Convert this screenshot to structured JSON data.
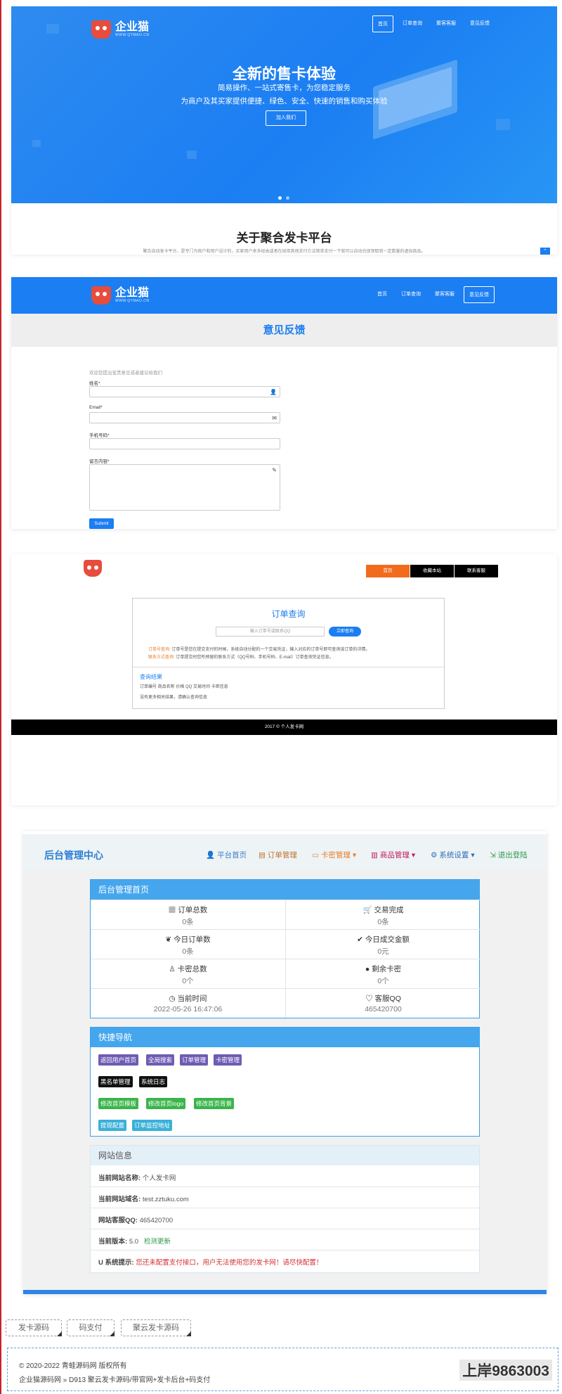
{
  "landing": {
    "logo_text": "企业猫",
    "logo_sub": "WWW.QYMAO.CN",
    "nav": [
      "首页",
      "订单查询",
      "聚客客服",
      "意见反馈"
    ],
    "hero_title": "全新的售卡体验",
    "hero_line1": "简易操作、一站式寄售卡，为您稳定服务",
    "hero_line2": "为商户及其买家提供便捷、绿色、安全、快速的销售和购买体验",
    "hero_button": "加入我们",
    "about_title": "关于聚合发卡平台",
    "about_text": "聚合自动发卡平台，是专门为商户和用户设计的，买家用户来多经由或者在线用其他支付方法简单支付一下就可以自动兑现领取到一定数量的虚拟商品。"
  },
  "feedback": {
    "logo_text": "企业猫",
    "logo_sub": "WWW.QYMAO.CN",
    "nav": [
      "首页",
      "订单查询",
      "聚客客服",
      "意见反馈"
    ],
    "title": "意见反馈",
    "hint": "欢迎您提出宝贵意见或者建议给我们",
    "name_label": "姓名*",
    "email_label": "Email*",
    "phone_label": "手机号码*",
    "message_label": "留言内容*",
    "submit": "Submit"
  },
  "order_query": {
    "buttons": [
      "首页",
      "收藏本站",
      "联系客服"
    ],
    "title": "订单查询",
    "input_placeholder": "输入订单号或联系QQ",
    "query_button": "立即查询",
    "note1_label": "订单号查询:",
    "note1_text": "订单号是您在提交支付的时候，系统自动分配的一个交易凭证，输入对应的订单号即可查询该订单的详情。",
    "note2_label": "联系方式查询:",
    "note2_text": "订单提交时您所预留的联系方式（QQ号码、手机号码、E-mail）订单查询凭证信息。",
    "result_title": "查询结果",
    "result_columns": "订单编号 商品名称 价格 QQ 交易时间 卡密信息",
    "result_empty": "没有更多相关结果，请确认查询信息",
    "footer": "2017 © 个人发卡网"
  },
  "admin": {
    "brand": "后台管理中心",
    "nav": [
      {
        "label": "平台首页",
        "icon": "user-icon",
        "color": "#3a7fc4"
      },
      {
        "label": "订单管理",
        "icon": "list-icon",
        "color": "#c0752a"
      },
      {
        "label": "卡密管理",
        "icon": "credit-card-icon",
        "color": "#e67e22"
      },
      {
        "label": "商品管理",
        "icon": "shop-icon",
        "color": "#c2185b"
      },
      {
        "label": "系统设置",
        "icon": "gear-icon",
        "color": "#2a6fb5"
      },
      {
        "label": "退出登陆",
        "icon": "logout-icon",
        "color": "#2e9a4a"
      }
    ],
    "home_panel_title": "后台管理首页",
    "stats": [
      {
        "label": "订单总数",
        "value": "0条",
        "icon": "grid-icon",
        "glyph": "▦"
      },
      {
        "label": "交易完成",
        "value": "0条",
        "icon": "cart-icon",
        "glyph": "🛒"
      },
      {
        "label": "今日订单数",
        "value": "0条",
        "icon": "leaf-icon",
        "glyph": "❦"
      },
      {
        "label": "今日成交金额",
        "value": "0元",
        "icon": "check-icon",
        "glyph": "✔"
      },
      {
        "label": "卡密总数",
        "value": "0个",
        "icon": "person-icon",
        "glyph": "♙"
      },
      {
        "label": "剩余卡密",
        "value": "0个",
        "icon": "circle-icon",
        "glyph": "●"
      },
      {
        "label": "当前时间",
        "value": "2022-05-26 16:47:06",
        "icon": "clock-icon",
        "glyph": "◷"
      },
      {
        "label": "客服QQ",
        "value": "465420700",
        "icon": "heart-icon",
        "glyph": "♡"
      }
    ],
    "quick_panel_title": "快捷导航",
    "quick_rows": [
      [
        {
          "label": "返回用户首页",
          "color": "#6e5cb4"
        },
        {
          "label": "全局搜索",
          "color": "#6e5cb4"
        },
        {
          "label": "订单管理",
          "color": "#6e5cb4"
        },
        {
          "label": "卡密管理",
          "color": "#6e5cb4"
        }
      ],
      [
        {
          "label": "黑名单管理",
          "color": "#111111"
        },
        {
          "label": "系统日志",
          "color": "#111111"
        }
      ],
      [
        {
          "label": "修改首页模板",
          "color": "#39b54a"
        },
        {
          "label": "修改首页logo",
          "color": "#39b54a"
        },
        {
          "label": "修改首页背景",
          "color": "#39b54a"
        }
      ],
      [
        {
          "label": "提现配置",
          "color": "#3ab0d8"
        },
        {
          "label": "订单监控地址",
          "color": "#3ab0d8"
        }
      ]
    ],
    "info_panel_title": "网站信息",
    "site_name_label": "当前网站名称:",
    "site_name": "个人发卡网",
    "domain_label": "当前网站域名:",
    "domain": "test.zztuku.com",
    "qq_label": "网站客服QQ:",
    "qq": "465420700",
    "version_label": "当前版本:",
    "version": "5.0",
    "update_link": "检测更新",
    "tip_label": "系统提示:",
    "tip_text": "您还未配置支付接口，用户无法使用您的发卡网！请尽快配置！"
  },
  "footer": {
    "tags": [
      "发卡源码",
      "码支付",
      "聚云发卡源码"
    ],
    "copyright": "© 2020-2022 青蛙源码网 版权所有",
    "breadcrumb": "企业猫源码网 » D913 聚云发卡源码/带官网+发卡后台+码支付",
    "watermark": "上岸9863003"
  }
}
